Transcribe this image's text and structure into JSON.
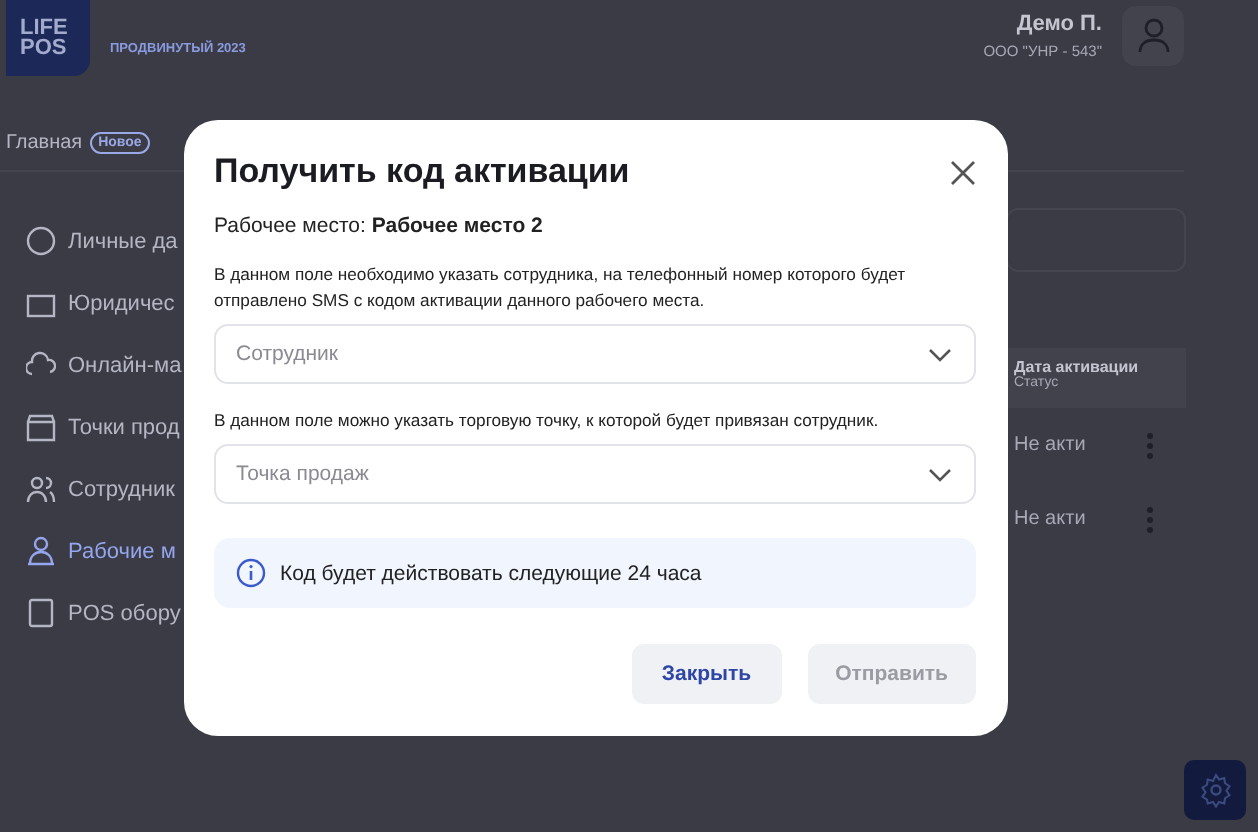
{
  "header": {
    "logo": [
      "LIFE",
      "POS"
    ],
    "plan": "ПРОДВИНУТЫЙ 2023",
    "user_name": "Демо П.",
    "company": "ООО \"УНР - 543\""
  },
  "nav": {
    "label": "Главная",
    "badge": "Новое"
  },
  "sidebar": {
    "items": [
      {
        "label": "Личные да",
        "selected": false
      },
      {
        "label": "Юридичес",
        "selected": false
      },
      {
        "label": "Онлайн-ма",
        "selected": false
      },
      {
        "label": "Точки прод",
        "selected": false
      },
      {
        "label": "Сотрудник",
        "selected": false
      },
      {
        "label": "Рабочие м",
        "selected": true
      },
      {
        "label": "POS обору",
        "selected": false
      }
    ]
  },
  "table": {
    "column": {
      "title": "Дата активации",
      "subtitle": "Статус"
    },
    "rows": [
      {
        "status": "Не акти"
      },
      {
        "status": "Не акти"
      }
    ]
  },
  "modal": {
    "title": "Получить код активации",
    "workplace": "Рабочее место: **Рабочее место 2**",
    "fields": [
      {
        "hint": "В данном поле необходимо указать сотрудника, на телефонный номер которого будет отправлено SMS с кодом активации данного рабочего места.",
        "placeholder": "Сотрудник"
      },
      {
        "hint": "В данном поле можно указать торговую точку, к которой будет привязан сотрудник.",
        "placeholder": "Точка продаж"
      }
    ],
    "info": "Код будет действовать следующие 24 часа",
    "buttons": [
      {
        "label": "Закрыть",
        "disabled": false
      },
      {
        "label": "Отправить",
        "disabled": true
      }
    ]
  }
}
